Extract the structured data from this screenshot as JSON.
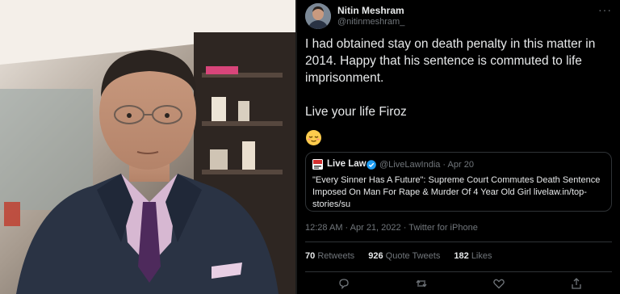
{
  "tweet": {
    "author_name": "Nitin Meshram",
    "author_handle": "@nitinmeshram_",
    "more_icon": "more-options-icon",
    "body_line1": "I had obtained stay on death penalty in this matter in 2014. Happy that his sentence is commuted to life imprisonment.",
    "body_line2": "Live your life Firoz",
    "emoji": "relieved-face-emoji",
    "timestamp": "12:28 AM · Apr 21, 2022 · Twitter for iPhone"
  },
  "quoted": {
    "name": "Live Law",
    "meta": "@LiveLawIndia · Apr 20",
    "text": "\"Every Sinner Has A Future\": Supreme Court Commutes Death Sentence Imposed On Man For Rape & Murder Of 4 Year Old Girl livelaw.in/top-stories/su"
  },
  "stats": {
    "retweets_count": "70",
    "retweets_label": "Retweets",
    "quotes_count": "926",
    "quotes_label": "Quote Tweets",
    "likes_count": "182",
    "likes_label": "Likes"
  },
  "actions": [
    "reply-icon",
    "retweet-icon",
    "like-icon",
    "share-icon"
  ],
  "colors": {
    "background": "#000000",
    "text": "#e7e9ea",
    "secondary": "#71767b",
    "border": "#2f3336",
    "verified": "#1d9bf0"
  }
}
